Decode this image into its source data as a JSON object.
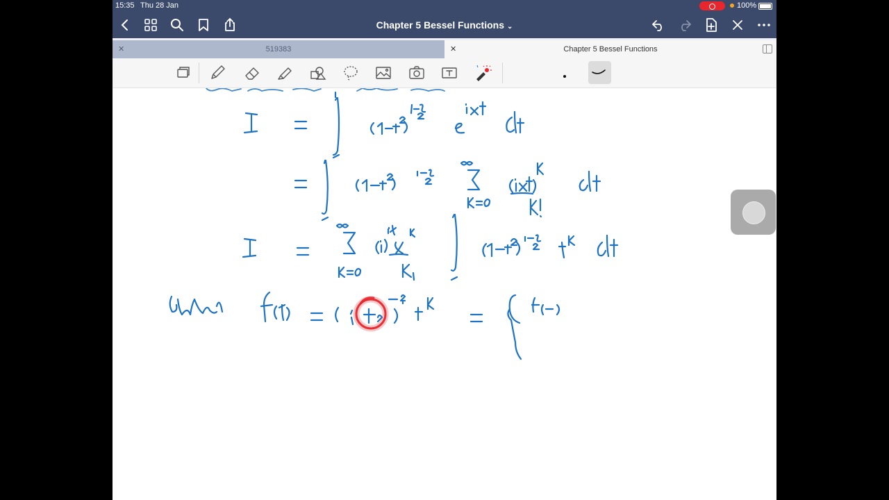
{
  "status_bar": {
    "time": "15:35",
    "date": "Thu 28 Jan",
    "battery": "100%"
  },
  "nav_bar": {
    "title": "Chapter 5 Bessel Functions"
  },
  "tabs": [
    {
      "label": "519383",
      "active": false
    },
    {
      "label": "Chapter 5 Bessel Functions",
      "active": true
    }
  ],
  "toolbar": {
    "tools": [
      "lasso-select-icon",
      "pen-icon",
      "eraser-icon",
      "highlighter-icon",
      "shapes-icon",
      "lasso-icon",
      "image-icon",
      "camera-icon",
      "text-box-icon",
      "laser-pointer-icon"
    ],
    "selected_tool": "laser-pointer-icon"
  },
  "canvas": {
    "content_type": "handwritten math notes",
    "ink_color": "#1f73c4",
    "highlight_color": "#e8262d"
  },
  "colors": {
    "nav": "#3b4a6b",
    "recording": "#e8262d"
  }
}
